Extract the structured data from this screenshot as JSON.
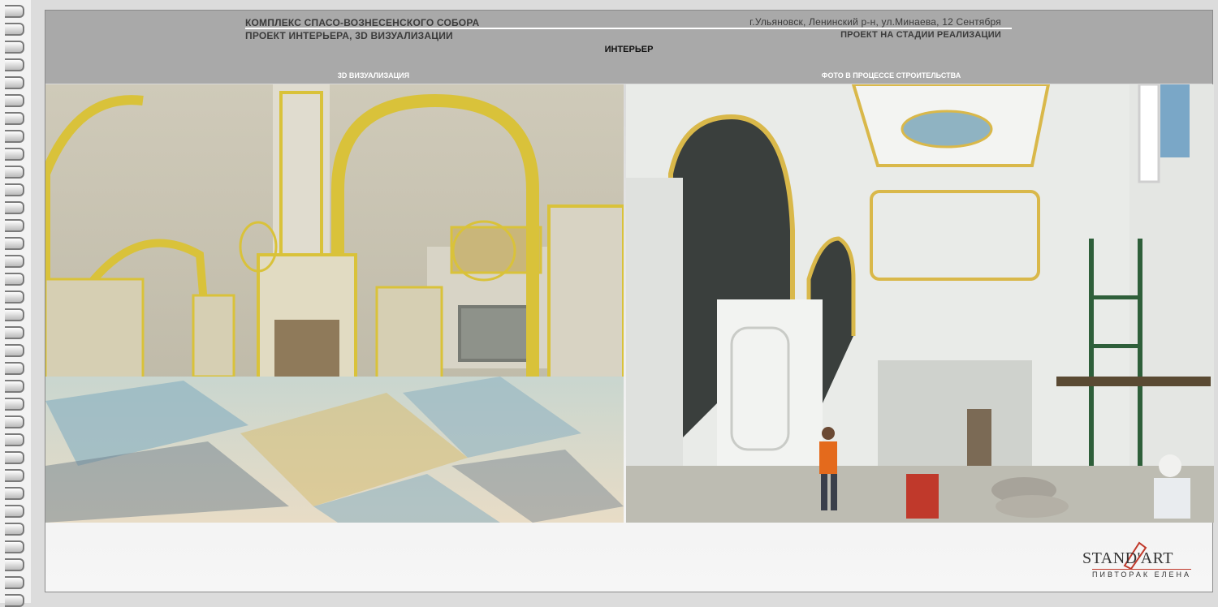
{
  "header": {
    "project_title": "КОМПЛЕКС СПАСО-ВОЗНЕСЕНСКОГО СОБОРА",
    "project_subtitle": "ПРОЕКТ ИНТЕРЬЕРА, 3D ВИЗУАЛИЗАЦИИ",
    "address": "г.Ульяновск, Ленинский р-н, ул.Минаева, 12 Сентября",
    "status": "ПРОЕКТ НА СТАДИИ РЕАЛИЗАЦИИ"
  },
  "section_title": "ИНТЕРЬЕР",
  "columns": {
    "left_label": "3D ВИЗУАЛИЗАЦИЯ",
    "right_label": "ФОТО В ПРОЦЕССЕ СТРОИТЕЛЬСТВА"
  },
  "logo": {
    "brand": "STAND'ART",
    "author": "ПИВТОРАК ЕЛЕНА"
  },
  "colors": {
    "header_bg": "#a9a9a9",
    "gold": "#d9c23a",
    "accent_red": "#c0392b"
  }
}
